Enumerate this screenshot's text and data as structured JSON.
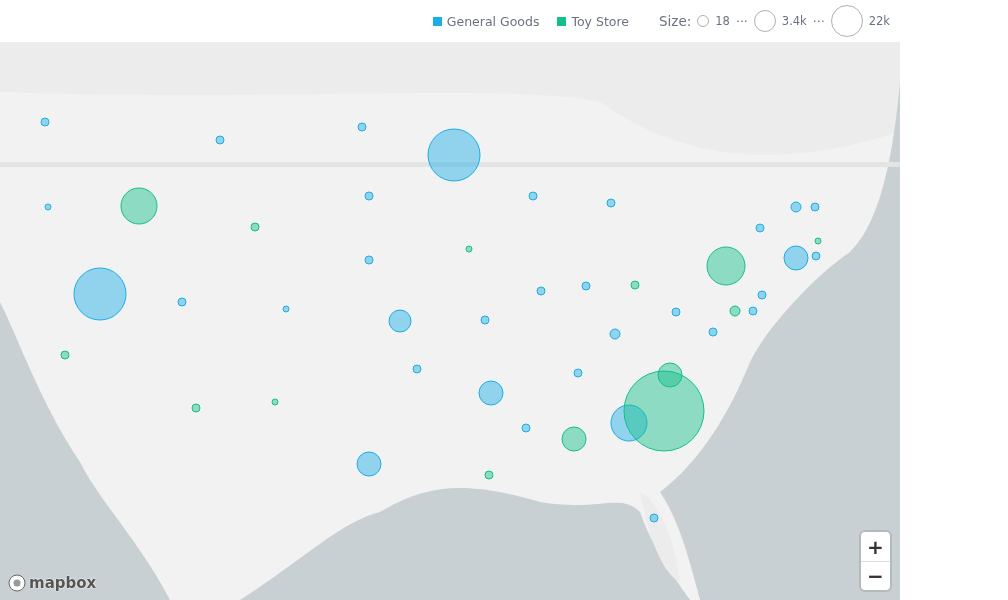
{
  "legend": {
    "series": [
      {
        "label": "General Goods",
        "color": "#1aaee5"
      },
      {
        "label": "Toy Store",
        "color": "#13bf8b"
      }
    ],
    "size": {
      "label": "Size:",
      "steps": [
        "18",
        "3.4k",
        "22k"
      ],
      "separator": "···"
    }
  },
  "map": {
    "kind": "picture",
    "attribution": "mapbox",
    "zoom_in": "+",
    "zoom_out": "−",
    "markers": [
      {
        "kind": "general_goods"
      },
      {
        "kind": "general_goods"
      },
      {
        "kind": "general_goods"
      },
      {
        "kind": "general_goods"
      },
      {
        "kind": "toy_store"
      },
      {
        "kind": "general_goods"
      },
      {
        "kind": "toy_store"
      },
      {
        "kind": "general_goods"
      },
      {
        "kind": "general_goods"
      },
      {
        "kind": "general_goods"
      },
      {
        "kind": "general_goods"
      },
      {
        "kind": "general_goods"
      },
      {
        "kind": "general_goods"
      },
      {
        "kind": "general_goods"
      },
      {
        "kind": "toy_store"
      },
      {
        "kind": "general_goods"
      },
      {
        "kind": "general_goods"
      },
      {
        "kind": "general_goods"
      },
      {
        "kind": "general_goods"
      },
      {
        "kind": "toy_store"
      },
      {
        "kind": "toy_store"
      },
      {
        "kind": "general_goods"
      },
      {
        "kind": "general_goods"
      },
      {
        "kind": "general_goods"
      },
      {
        "kind": "general_goods"
      },
      {
        "kind": "general_goods"
      },
      {
        "kind": "toy_store"
      },
      {
        "kind": "toy_store"
      },
      {
        "kind": "general_goods"
      },
      {
        "kind": "general_goods"
      },
      {
        "kind": "general_goods"
      },
      {
        "kind": "general_goods"
      },
      {
        "kind": "general_goods"
      },
      {
        "kind": "general_goods"
      },
      {
        "kind": "toy_store"
      },
      {
        "kind": "toy_store"
      },
      {
        "kind": "toy_store"
      },
      {
        "kind": "general_goods"
      },
      {
        "kind": "general_goods"
      },
      {
        "kind": "general_goods"
      },
      {
        "kind": "toy_store"
      },
      {
        "kind": "general_goods"
      },
      {
        "kind": "toy_store"
      },
      {
        "kind": "toy_store"
      },
      {
        "kind": "general_goods"
      },
      {
        "kind": "toy_store"
      },
      {
        "kind": "general_goods"
      }
    ]
  }
}
